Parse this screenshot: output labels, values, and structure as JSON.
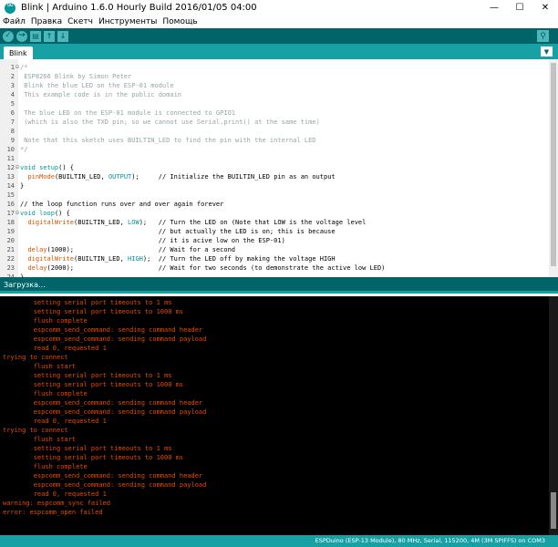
{
  "window": {
    "title": "Blink | Arduino 1.6.0 Hourly Build 2016/01/05 04:00",
    "minimize": "—",
    "maximize": "☐",
    "close": "✕"
  },
  "menu": [
    "Файл",
    "Правка",
    "Скетч",
    "Инструменты",
    "Помощь"
  ],
  "toolbar": {
    "verify": "✓",
    "upload": "→",
    "new": "▤",
    "open": "↑",
    "save": "↓",
    "serial_monitor": "⚲"
  },
  "tabs": {
    "active": "Blink",
    "menu": "▼"
  },
  "editor": {
    "lines": [
      {
        "n": "1",
        "f": "⊟",
        "parts": [
          {
            "t": "/*",
            "c": "cmt"
          }
        ]
      },
      {
        "n": "2",
        "f": "",
        "parts": [
          {
            "t": " ESP8266 Blink by Simon Peter",
            "c": "cmt"
          }
        ]
      },
      {
        "n": "3",
        "f": "",
        "parts": [
          {
            "t": " Blink the blue LED on the ESP-01 module",
            "c": "cmt"
          }
        ]
      },
      {
        "n": "4",
        "f": "",
        "parts": [
          {
            "t": " This example code is in the public domain",
            "c": "cmt"
          }
        ]
      },
      {
        "n": "5",
        "f": "",
        "parts": [
          {
            "t": "",
            "c": "cmt"
          }
        ]
      },
      {
        "n": "6",
        "f": "",
        "parts": [
          {
            "t": " The blue LED on the ESP-01 module is connected to GPIO1",
            "c": "cmt"
          }
        ]
      },
      {
        "n": "7",
        "f": "",
        "parts": [
          {
            "t": " (which is also the TXD pin; so we cannot use Serial.print() at the same time)",
            "c": "cmt"
          }
        ]
      },
      {
        "n": "8",
        "f": "",
        "parts": [
          {
            "t": "",
            "c": "cmt"
          }
        ]
      },
      {
        "n": "9",
        "f": "",
        "parts": [
          {
            "t": " Note that this sketch uses BUILTIN_LED to find the pin with the internal LED",
            "c": "cmt"
          }
        ]
      },
      {
        "n": "10",
        "f": "",
        "parts": [
          {
            "t": "*/",
            "c": "cmt"
          }
        ]
      },
      {
        "n": "11",
        "f": "",
        "parts": []
      },
      {
        "n": "12",
        "f": "⊟",
        "parts": [
          {
            "t": "void",
            "c": "kw"
          },
          {
            "t": " ",
            "c": "code"
          },
          {
            "t": "setup",
            "c": "kw"
          },
          {
            "t": "() {",
            "c": "code"
          }
        ]
      },
      {
        "n": "13",
        "f": "",
        "parts": [
          {
            "t": "  ",
            "c": "code"
          },
          {
            "t": "pinMode",
            "c": "fn"
          },
          {
            "t": "(BUILTIN_LED, ",
            "c": "code"
          },
          {
            "t": "OUTPUT",
            "c": "const"
          },
          {
            "t": ");     // Initialize the BUILTIN_LED pin as an output",
            "c": "code"
          }
        ]
      },
      {
        "n": "14",
        "f": "",
        "parts": [
          {
            "t": "}",
            "c": "code"
          }
        ]
      },
      {
        "n": "15",
        "f": "",
        "parts": []
      },
      {
        "n": "16",
        "f": "",
        "parts": [
          {
            "t": "// the loop function runs over and over again forever",
            "c": "code"
          }
        ]
      },
      {
        "n": "17",
        "f": "⊟",
        "parts": [
          {
            "t": "void",
            "c": "kw"
          },
          {
            "t": " ",
            "c": "code"
          },
          {
            "t": "loop",
            "c": "kw"
          },
          {
            "t": "() {",
            "c": "code"
          }
        ]
      },
      {
        "n": "18",
        "f": "",
        "parts": [
          {
            "t": "  ",
            "c": "code"
          },
          {
            "t": "digitalWrite",
            "c": "fn"
          },
          {
            "t": "(BUILTIN_LED, ",
            "c": "code"
          },
          {
            "t": "LOW",
            "c": "const"
          },
          {
            "t": ");   // Turn the LED on (Note that LOW is the voltage level",
            "c": "code"
          }
        ]
      },
      {
        "n": "19",
        "f": "",
        "parts": [
          {
            "t": "                                    // but actually the LED is on; this is because",
            "c": "code"
          }
        ]
      },
      {
        "n": "20",
        "f": "",
        "parts": [
          {
            "t": "                                    // it is acive low on the ESP-01)",
            "c": "code"
          }
        ]
      },
      {
        "n": "21",
        "f": "",
        "parts": [
          {
            "t": "  ",
            "c": "code"
          },
          {
            "t": "delay",
            "c": "fn"
          },
          {
            "t": "(1000);                      // Wait for a second",
            "c": "code"
          }
        ]
      },
      {
        "n": "22",
        "f": "",
        "parts": [
          {
            "t": "  ",
            "c": "code"
          },
          {
            "t": "digitalWrite",
            "c": "fn"
          },
          {
            "t": "(BUILTIN_LED, ",
            "c": "code"
          },
          {
            "t": "HIGH",
            "c": "const"
          },
          {
            "t": ");  // Turn the LED off by making the voltage HIGH",
            "c": "code"
          }
        ]
      },
      {
        "n": "23",
        "f": "",
        "parts": [
          {
            "t": "  ",
            "c": "code"
          },
          {
            "t": "delay",
            "c": "fn"
          },
          {
            "t": "(2000);                      // Wait for two seconds (to demonstrate the active low LED)",
            "c": "code"
          }
        ]
      },
      {
        "n": "24",
        "f": "",
        "parts": [
          {
            "t": "}",
            "c": "code"
          }
        ]
      }
    ]
  },
  "status": {
    "text": "Загрузка..."
  },
  "console": {
    "lines": [
      "        setting serial port timeouts to 1 ms",
      "        setting serial port timeouts to 1000 ms",
      "        flush complete",
      "        espcomm_send_command: sending command header",
      "        espcomm_send_command: sending command payload",
      "        read 0, requested 1",
      "trying to connect",
      "        flush start",
      "        setting serial port timeouts to 1 ms",
      "        setting serial port timeouts to 1000 ms",
      "        flush complete",
      "        espcomm_send_command: sending command header",
      "        espcomm_send_command: sending command payload",
      "        read 0, requested 1",
      "trying to connect",
      "        flush start",
      "        setting serial port timeouts to 1 ms",
      "        setting serial port timeouts to 1000 ms",
      "        flush complete",
      "        espcomm_send_command: sending command header",
      "        espcomm_send_command: sending command payload",
      "        read 0, requested 1",
      "warning: espcomm_sync failed",
      "error: espcomm_open failed"
    ]
  },
  "footer": {
    "board": "ESPDuino (ESP-13 Module), 80 MHz, Serial, 115200, 4M (3M SPIFFS) on COM3"
  },
  "colors": {
    "toolbar": "#006468",
    "tab_strip": "#17a1a5",
    "console_bg": "#000000",
    "console_text": "#e34c00",
    "comment": "#95a5a6",
    "keyword": "#00979c",
    "function": "#d35400"
  }
}
